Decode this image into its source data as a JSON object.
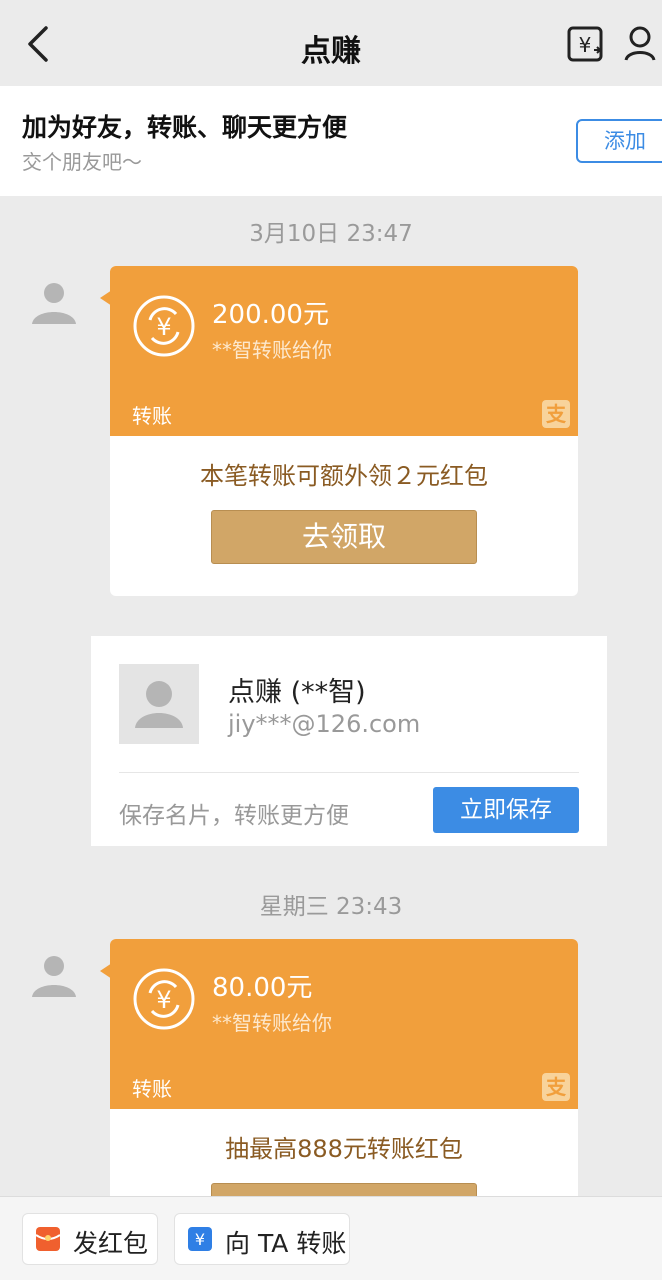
{
  "nav": {
    "title": "点赚"
  },
  "friend_bar": {
    "title": "加为好友，转账、聊天更方便",
    "subtitle": "交个朋友吧～",
    "add_label": "添加"
  },
  "messages": [
    {
      "time": "3月10日 23:47",
      "amount": "200.00元",
      "from": "**智转账给你",
      "label": "转账",
      "promo": "本笔转账可额外领２元红包",
      "button": "去领取"
    },
    {
      "time": "星期三 23:43",
      "amount": "80.00元",
      "from": "**智转账给你",
      "label": "转账",
      "promo": "抽最高888元转账红包"
    }
  ],
  "name_card": {
    "name": "点赚 (**智)",
    "email": "jiy***@126.com",
    "hint": "保存名片，转账更方便",
    "save_label": "立即保存"
  },
  "bottom_bar": {
    "red_packet_label": "发红包",
    "transfer_label": "向 TA 转账"
  },
  "colors": {
    "orange": "#f19f3c",
    "blue": "#3c8ce4",
    "gold": "#d1a667"
  },
  "icons": {
    "alipay": "支"
  }
}
